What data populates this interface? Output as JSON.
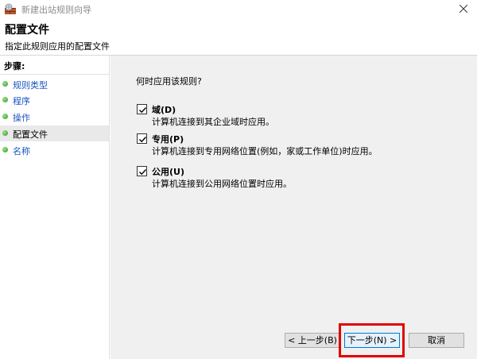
{
  "window": {
    "title": "新建出站规则向导",
    "icon": "firewall-wizard-icon",
    "close_icon": "close-icon"
  },
  "header": {
    "title": "配置文件",
    "subtitle": "指定此规则应用的配置文件"
  },
  "sidebar": {
    "steps_label": "步骤:",
    "items": [
      {
        "label": "规则类型",
        "state": "link"
      },
      {
        "label": "程序",
        "state": "link"
      },
      {
        "label": "操作",
        "state": "link"
      },
      {
        "label": "配置文件",
        "state": "current"
      },
      {
        "label": "名称",
        "state": "link"
      }
    ]
  },
  "main": {
    "question": "何时应用该规则?",
    "options": [
      {
        "label": "域(D)",
        "description": "计算机连接到其企业域时应用。",
        "checked": true
      },
      {
        "label": "专用(P)",
        "description": "计算机连接到专用网络位置(例如，家或工作单位)时应用。",
        "checked": true
      },
      {
        "label": "公用(U)",
        "description": "计算机连接到公用网络位置时应用。",
        "checked": true
      }
    ]
  },
  "footer": {
    "back_label": "< 上一步(B)",
    "next_label": "下一步(N) >",
    "cancel_label": "取消"
  },
  "colors": {
    "accent": "#0078d7",
    "highlight": "#e00000",
    "link": "#1a55c0",
    "content_bg": "#f0f0f0"
  }
}
